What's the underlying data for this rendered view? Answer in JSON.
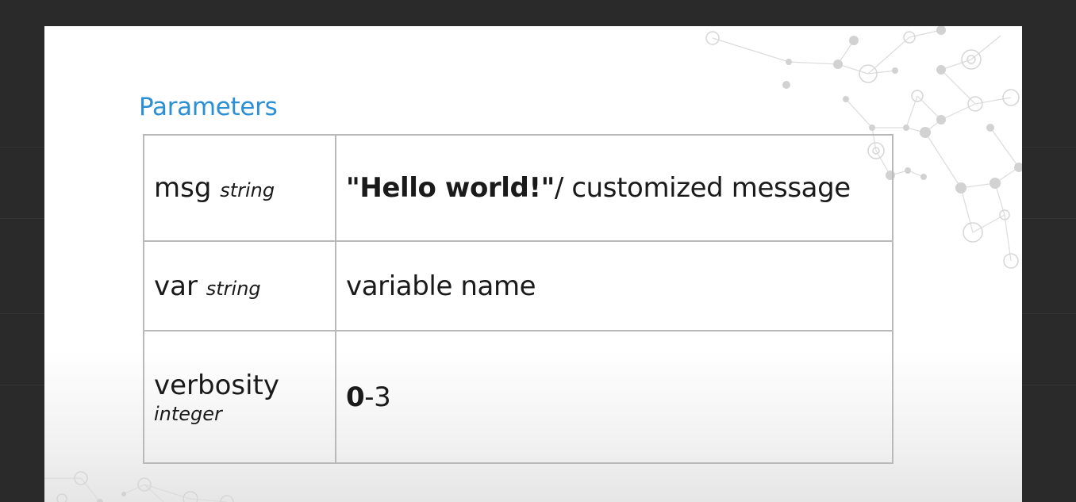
{
  "slide": {
    "title": "Parameters",
    "parameters": [
      {
        "name": "msg",
        "type": "string",
        "desc_bold": "\"Hello world!\"",
        "desc_rest": "/ customized message"
      },
      {
        "name": "var",
        "type": "string",
        "desc_bold": "",
        "desc_rest": "variable name"
      },
      {
        "name": "verbosity",
        "type": "integer",
        "desc_bold": "0",
        "desc_rest": "-3"
      }
    ]
  },
  "colors": {
    "title": "#2a8fd4",
    "table_border": "#b9b9b9",
    "background_frame": "#2a2a2a",
    "network_lines": "#d8d8d8"
  },
  "decorations": {
    "background_pattern": "molecule-network-icon"
  }
}
